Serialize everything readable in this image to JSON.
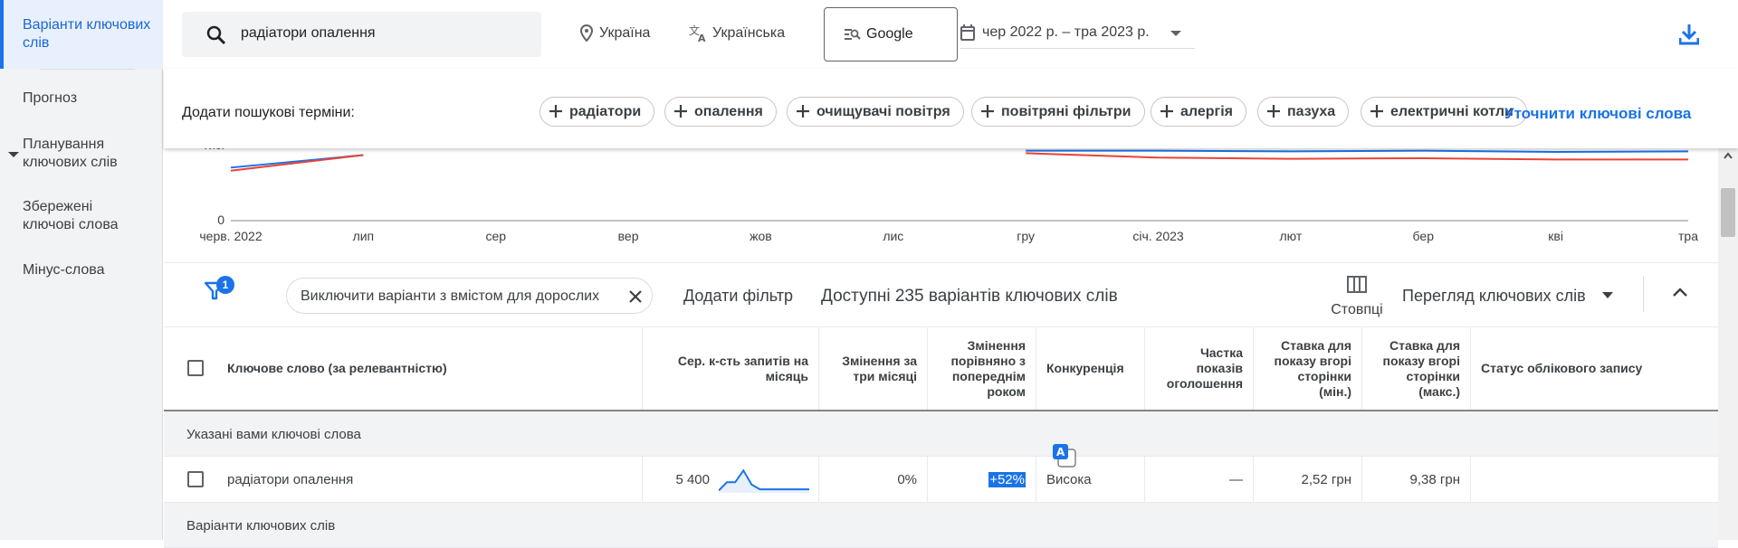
{
  "sidebar": {
    "items": [
      {
        "label": "Варіанти ключових слів",
        "active": true
      },
      {
        "label": "Прогноз"
      },
      {
        "label": "Планування ключових слів"
      },
      {
        "label": "Збережені ключові слова"
      },
      {
        "label": "Мінус-слова"
      }
    ]
  },
  "topbar": {
    "search_value": "радіатори опалення",
    "location": "Україна",
    "language": "Українська",
    "network": "Google",
    "date_range": "чер 2022 р. – тра 2023 р."
  },
  "termbar": {
    "label": "Додати пошукові терміни:",
    "chips": [
      "радіатори",
      "опалення",
      "очищувачі повітря",
      "повітряні фільтри",
      "алергія",
      "пазуха",
      "електричні котли"
    ],
    "refine_link": "Уточнити ключові слова"
  },
  "chart_data": {
    "type": "line",
    "x_labels": [
      "черв. 2022",
      "лип",
      "сер",
      "вер",
      "жов",
      "лис",
      "гру",
      "січ. 2023",
      "лют",
      "бер",
      "кві",
      "тра"
    ],
    "y_tick_visible": [
      "0",
      "Тис."
    ],
    "series_colors": [
      "#1a73e8",
      "#ea4335"
    ],
    "series": [
      {
        "values": [
          8500,
          10500,
          null,
          null,
          null,
          null,
          11200,
          11200,
          11100,
          11200,
          11000,
          11100
        ]
      },
      {
        "values": [
          8000,
          10500,
          null,
          null,
          null,
          null,
          10800,
          10100,
          9900,
          10000,
          9800,
          9800
        ]
      }
    ],
    "ylim": [
      0,
      12600
    ]
  },
  "filterbar": {
    "filter_count": "1",
    "exclude_chip": "Виключити варіанти з вмістом для дорослих",
    "add_filter": "Додати фільтр",
    "available": "Доступні 235 варіантів ключових слів",
    "columns": "Стовпці",
    "view": "Перегляд ключових слів"
  },
  "table": {
    "headers": [
      "Ключове слово (за релевантністю)",
      "Сер. к-сть запитів на місяць",
      "Змінення за три місяці",
      "Змінення порівняно з попереднім роком",
      "Конкуренція",
      "Частка показів оголошення",
      "Ставка для показу вгорі сторінки (мін.)",
      "Ставка для показу вгорі сторінки (макс.)",
      "Статус облікового запису"
    ],
    "group_provided": "Указані вами ключові слова",
    "rows": [
      {
        "keyword": "радіатори опалення",
        "avg_searches": "5 400",
        "trend": [
          0.1,
          0.45,
          0.45,
          0.95,
          0.35,
          0.15,
          0.15,
          0.15,
          0.15,
          0.15,
          0.15,
          0.15
        ],
        "three_month_change": "0%",
        "yoy_change": "+52%",
        "competition": "Висока",
        "impression_share": "—",
        "bid_low": "2,52 грн",
        "bid_high": "9,38 грн",
        "status": ""
      }
    ],
    "group_ideas": "Варіанти ключових слів"
  },
  "colors": {
    "accent": "#1a73e8",
    "series_blue": "#1a73e8",
    "series_red": "#ea4335"
  }
}
